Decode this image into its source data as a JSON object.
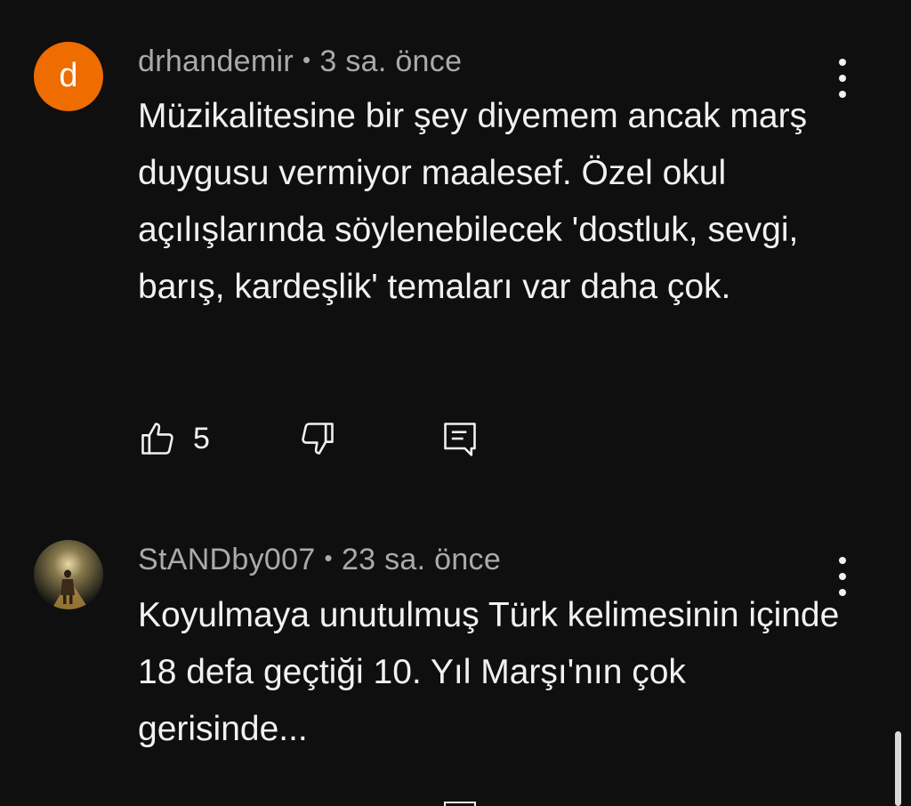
{
  "comments": [
    {
      "avatar_letter": "d",
      "author": "drhandemir",
      "separator": "•",
      "time": "3 sa. önce",
      "text": "Müzikalitesine bir şey diyemem ancak marş duygusu vermiyor maalesef. Özel okul açılışlarında söylenebilecek 'dostluk, sevgi, barış, kardeşlik' temaları var daha çok.",
      "likes": "5",
      "icons": {
        "like": "thumbs-up-icon",
        "dislike": "thumbs-down-icon",
        "reply": "reply-icon",
        "more": "more-vertical-icon"
      },
      "avatar_color": "#ef6c00"
    },
    {
      "author": "StANDby007",
      "separator": "•",
      "time": "23 sa. önce",
      "text": "Koyulmaya unutulmuş Türk kelimesinin içinde 18 defa geçtiği 10. Yıl Marşı'nın çok gerisinde...",
      "icons": {
        "more": "more-vertical-icon",
        "avatar": "photo-avatar"
      }
    }
  ],
  "colors": {
    "background": "#0f0f0f",
    "text": "#f1f1f1",
    "meta": "#aaaaaa"
  }
}
